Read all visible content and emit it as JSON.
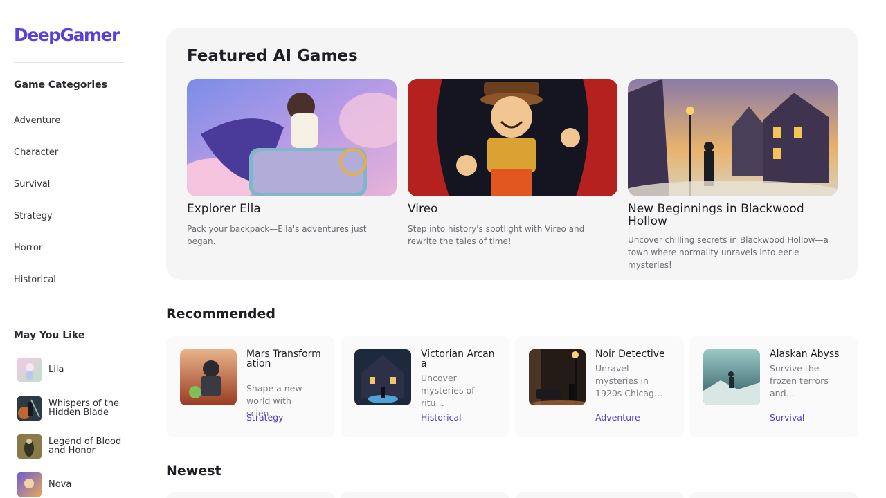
{
  "brand": {
    "logo": "DeepGamer",
    "accent": "#5a3fd8"
  },
  "sidebar": {
    "categories_heading": "Game Categories",
    "categories": [
      "Adventure",
      "Character",
      "Survival",
      "Strategy",
      "Horror",
      "Historical"
    ],
    "like_heading": "May You Like",
    "likes": [
      {
        "label": "Lila"
      },
      {
        "label": "Whispers of the Hidden Blade"
      },
      {
        "label": "Legend of Blood and Honor"
      },
      {
        "label": "Nova"
      }
    ]
  },
  "featured": {
    "title": "Featured AI Games",
    "games": [
      {
        "name": "Explorer Ella",
        "desc": "Pack your backpack—Ella's adventures just began."
      },
      {
        "name": "Vireo",
        "desc": "Step into history's spotlight with Vireo and rewrite the tales of time!"
      },
      {
        "name": "New Beginnings in Blackwood Hollow",
        "desc": "Uncover chilling secrets in Blackwood Hollow—a town where normality unravels into eerie mysteries!"
      }
    ]
  },
  "recommended": {
    "title": "Recommended",
    "games": [
      {
        "name": "Mars Transformation",
        "desc": "Shape a new world with scien…",
        "tag": "Strategy"
      },
      {
        "name": "Victorian Arcana",
        "desc": "Uncover mysteries of ritu…",
        "tag": "Historical"
      },
      {
        "name": "Noir Detective",
        "desc": "Unravel mysteries in 1920s Chicag…",
        "tag": "Adventure"
      },
      {
        "name": "Alaskan Abyss",
        "desc": "Survive the frozen terrors and…",
        "tag": "Survival"
      }
    ]
  },
  "newest": {
    "title": "Newest"
  }
}
